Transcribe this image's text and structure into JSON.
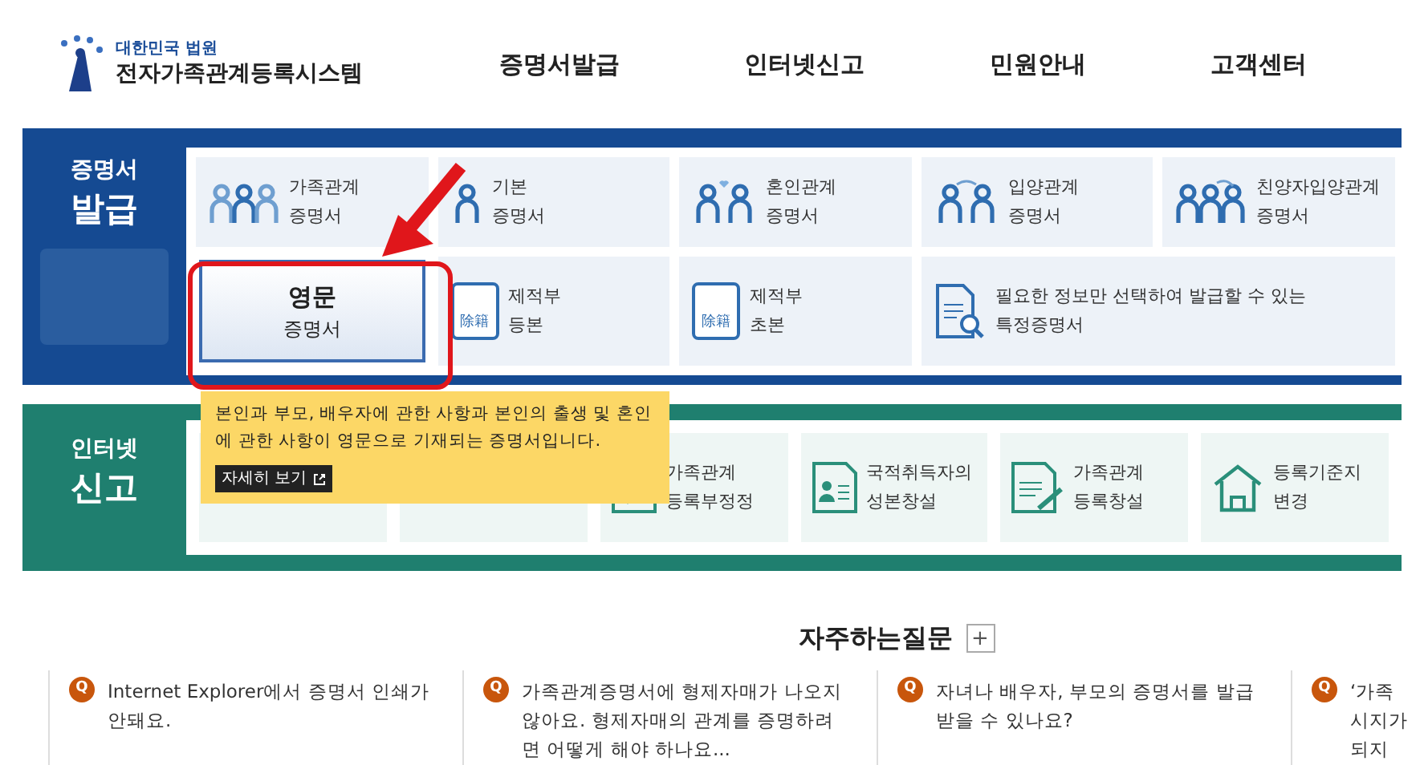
{
  "header": {
    "court": "대한민국 법원",
    "system": "전자가족관계등록시스템",
    "nav": [
      {
        "label": "증명서발급"
      },
      {
        "label": "인터넷신고"
      },
      {
        "label": "민원안내"
      },
      {
        "label": "고객센터"
      }
    ]
  },
  "issue": {
    "title_small": "증명서",
    "title_big": "발급",
    "tiles": [
      {
        "kind": "family",
        "lines": [
          "가족관계",
          "증명서"
        ],
        "highlighted": false
      },
      {
        "kind": "person",
        "lines": [
          "기본",
          "증명서"
        ],
        "highlighted": false
      },
      {
        "kind": "couple",
        "lines": [
          "혼인관계",
          "증명서"
        ],
        "highlighted": false
      },
      {
        "kind": "adopt",
        "lines": [
          "입양관계",
          "증명서"
        ],
        "highlighted": false
      },
      {
        "kind": "adoptfamily",
        "lines": [
          "친양자입양관계",
          "증명서"
        ],
        "highlighted": false
      },
      {
        "kind": "plain",
        "lines": [
          "영문",
          "증명서"
        ],
        "highlighted": true
      },
      {
        "kind": "doc",
        "badge": "除籍",
        "lines": [
          "제적부",
          "등본"
        ],
        "highlighted": false
      },
      {
        "kind": "doc",
        "badge": "除籍",
        "lines": [
          "제적부",
          "초본"
        ],
        "highlighted": false
      },
      {
        "kind": "search",
        "lines": [
          "필요한 정보만 선택하여 발급할 수 있는",
          "특정증명서"
        ],
        "highlighted": false
      }
    ]
  },
  "report": {
    "title_small": "인터넷",
    "title_big": "신고",
    "tiles": [
      {
        "kind": "hidden"
      },
      {
        "kind": "hidden"
      },
      {
        "kind": "check",
        "lines": [
          "가족관계",
          "등록부정정"
        ]
      },
      {
        "kind": "idcard",
        "lines": [
          "국적취득자의",
          "성본창설"
        ]
      },
      {
        "kind": "pen",
        "lines": [
          "가족관계",
          "등록창설"
        ]
      },
      {
        "kind": "house",
        "lines": [
          "등록기준지",
          "변경"
        ]
      }
    ]
  },
  "tooltip": {
    "text": "본인과 부모, 배우자에 관한 사항과 본인의 출생 및 혼인에 관한 사항이 영문으로 기재되는 증명서입니다.",
    "link": "자세히 보기"
  },
  "faq": {
    "title": "자주하는질문",
    "more": "+",
    "items": [
      {
        "mark": "Q",
        "lines": [
          "Internet Explorer에서 증명서 인쇄가",
          "안돼요."
        ]
      },
      {
        "mark": "Q",
        "lines": [
          "가족관계증명서에 형제자매가 나오지",
          "않아요. 형제자매의 관계를 증명하려",
          "면 어떻게 해야 하나요..."
        ]
      },
      {
        "mark": "Q",
        "lines": [
          "자녀나 배우자, 부모의 증명서를 발급",
          "받을 수 있나요?"
        ]
      },
      {
        "mark": "Q",
        "lines": [
          "‘가족",
          "시지가",
          "되지"
        ]
      }
    ]
  }
}
